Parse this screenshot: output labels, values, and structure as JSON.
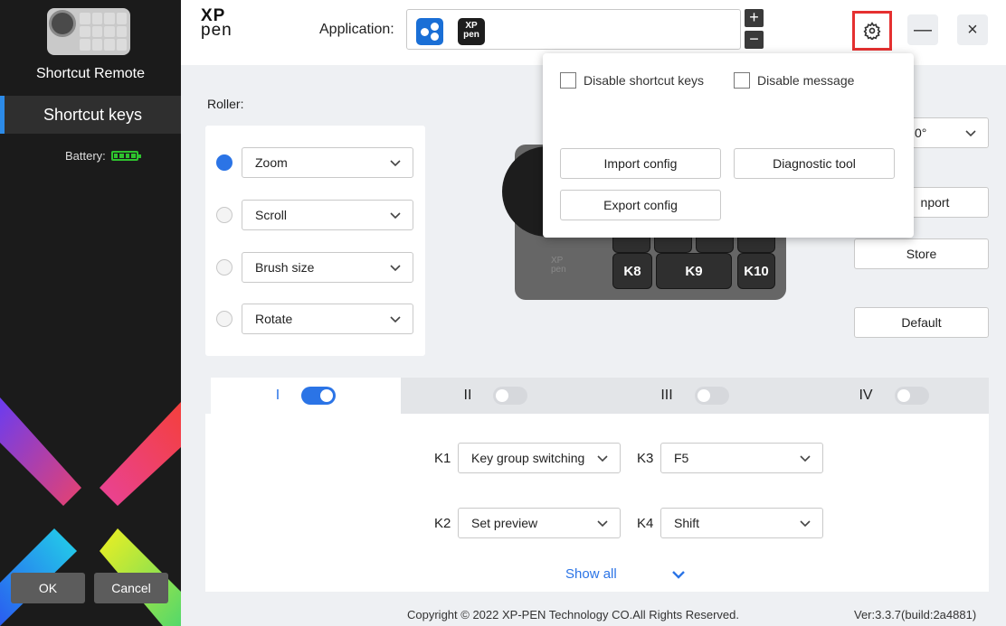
{
  "sidebar": {
    "device_name": "Shortcut Remote",
    "nav_item": "Shortcut keys",
    "battery_label": "Battery:",
    "ok_label": "OK",
    "cancel_label": "Cancel"
  },
  "header": {
    "logo_line1": "XP",
    "logo_line2": "pen",
    "application_label": "Application:",
    "app_icon2_text_line1": "XP",
    "app_icon2_text_line2": "pen",
    "plus": "+",
    "minus": "−",
    "minimize": "—",
    "close": "×"
  },
  "roller": {
    "label": "Roller:",
    "options": [
      {
        "label": "Zoom",
        "selected": true
      },
      {
        "label": "Scroll",
        "selected": false
      },
      {
        "label": "Brush size",
        "selected": false
      },
      {
        "label": "Rotate",
        "selected": false
      }
    ]
  },
  "device": {
    "keys": [
      "K8",
      "K9",
      "K10"
    ],
    "logo_line1": "XP",
    "logo_line2": "pen"
  },
  "right_panel": {
    "rotation_value": "0°",
    "import_label": "nport",
    "store_label": "Store",
    "default_label": "Default"
  },
  "settings_popup": {
    "disable_shortcut_keys": "Disable shortcut keys",
    "disable_message": "Disable message",
    "import_config": "Import config",
    "diagnostic_tool": "Diagnostic tool",
    "export_config": "Export config"
  },
  "tabs": [
    {
      "label": "I",
      "enabled": true,
      "active": true
    },
    {
      "label": "II",
      "enabled": false,
      "active": false
    },
    {
      "label": "III",
      "enabled": false,
      "active": false
    },
    {
      "label": "IV",
      "enabled": false,
      "active": false
    }
  ],
  "keys": [
    {
      "id": "K1",
      "value": "Key group switching"
    },
    {
      "id": "K3",
      "value": "F5"
    },
    {
      "id": "K2",
      "value": "Set preview"
    },
    {
      "id": "K4",
      "value": "Shift"
    }
  ],
  "show_all": "Show all",
  "footer": {
    "copyright": "Copyright © 2022  XP-PEN Technology CO.All Rights Reserved.",
    "version": "Ver:3.3.7(build:2a4881)"
  },
  "colors": {
    "accent": "#2b74e6",
    "highlight": "#e53030",
    "battery": "#2ec32e",
    "sidebar_bg": "#1b1b1b"
  }
}
